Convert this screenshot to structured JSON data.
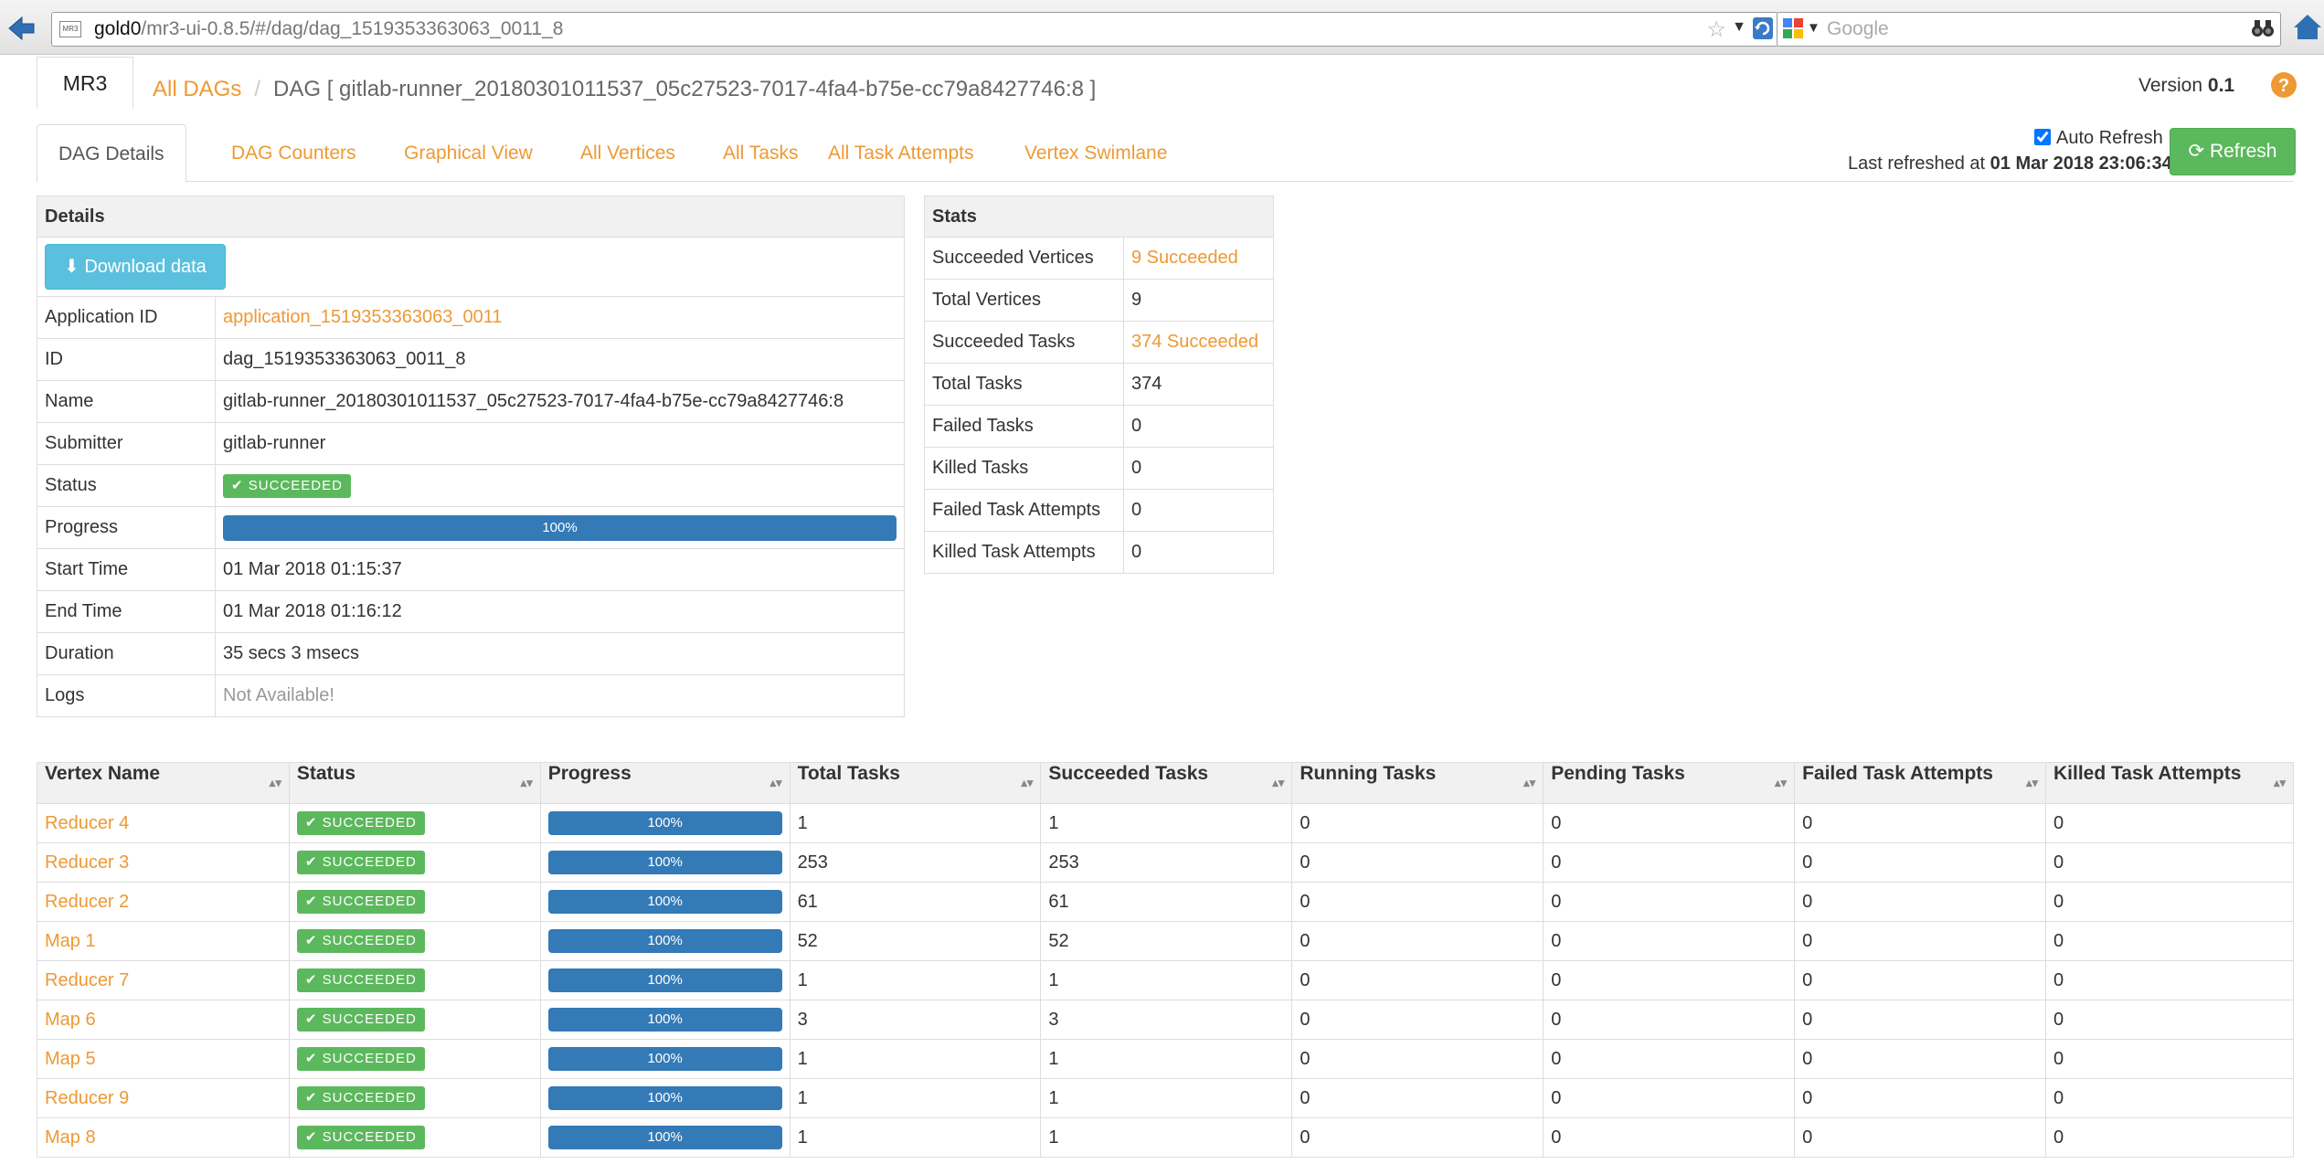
{
  "browser": {
    "url_host": "gold0",
    "url_path": "/mr3-ui-0.8.5/#/dag/dag_1519353363063_0011_8",
    "favicon_text": "MR3",
    "search_placeholder": "Google"
  },
  "header": {
    "logo": "MR3",
    "breadcrumb_root": "All DAGs",
    "breadcrumb_separator": "/",
    "breadcrumb_current": "DAG [ gitlab-runner_20180301011537_05c27523-7017-4fa4-b75e-cc79a8427746:8 ]",
    "version_label": "Version",
    "version_value": "0.1"
  },
  "tabs": [
    {
      "label": "DAG Details",
      "active": true
    },
    {
      "label": "DAG Counters"
    },
    {
      "label": "Graphical View"
    },
    {
      "label": "All Vertices"
    },
    {
      "label": "All Tasks"
    },
    {
      "label": "All Task Attempts"
    },
    {
      "label": "Vertex Swimlane"
    }
  ],
  "refresh": {
    "auto_refresh_label": "Auto Refresh",
    "auto_refresh_checked": true,
    "last_refreshed_label": "Last refreshed at",
    "last_refreshed_value": "01 Mar 2018 23:06:34",
    "button_label": "Refresh"
  },
  "details": {
    "title": "Details",
    "download_label": "Download data",
    "rows": {
      "application_id": {
        "label": "Application ID",
        "value": "application_1519353363063_0011"
      },
      "id": {
        "label": "ID",
        "value": "dag_1519353363063_0011_8"
      },
      "name": {
        "label": "Name",
        "value": "gitlab-runner_20180301011537_05c27523-7017-4fa4-b75e-cc79a8427746:8"
      },
      "submitter": {
        "label": "Submitter",
        "value": "gitlab-runner"
      },
      "status": {
        "label": "Status",
        "value": "SUCCEEDED"
      },
      "progress": {
        "label": "Progress",
        "value": "100%",
        "fraction": 1.0
      },
      "start_time": {
        "label": "Start Time",
        "value": "01 Mar 2018 01:15:37"
      },
      "end_time": {
        "label": "End Time",
        "value": "01 Mar 2018 01:16:12"
      },
      "duration": {
        "label": "Duration",
        "value": "35 secs 3 msecs"
      },
      "logs": {
        "label": "Logs",
        "value": "Not Available!"
      }
    }
  },
  "stats": {
    "title": "Stats",
    "rows": [
      {
        "label": "Succeeded Vertices",
        "value": "9 Succeeded",
        "link": true
      },
      {
        "label": "Total Vertices",
        "value": "9"
      },
      {
        "label": "Succeeded Tasks",
        "value": "374 Succeeded",
        "link": true
      },
      {
        "label": "Total Tasks",
        "value": "374"
      },
      {
        "label": "Failed Tasks",
        "value": "0"
      },
      {
        "label": "Killed Tasks",
        "value": "0"
      },
      {
        "label": "Failed Task Attempts",
        "value": "0"
      },
      {
        "label": "Killed Task Attempts",
        "value": "0"
      }
    ]
  },
  "vertices": {
    "columns": [
      "Vertex Name",
      "Status",
      "Progress",
      "Total Tasks",
      "Succeeded Tasks",
      "Running Tasks",
      "Pending Tasks",
      "Failed Task Attempts",
      "Killed Task Attempts"
    ],
    "rows": [
      {
        "name": "Reducer 4",
        "status": "SUCCEEDED",
        "progress": "100%",
        "total": "1",
        "succeeded": "1",
        "running": "0",
        "pending": "0",
        "failed": "0",
        "killed": "0"
      },
      {
        "name": "Reducer 3",
        "status": "SUCCEEDED",
        "progress": "100%",
        "total": "253",
        "succeeded": "253",
        "running": "0",
        "pending": "0",
        "failed": "0",
        "killed": "0"
      },
      {
        "name": "Reducer 2",
        "status": "SUCCEEDED",
        "progress": "100%",
        "total": "61",
        "succeeded": "61",
        "running": "0",
        "pending": "0",
        "failed": "0",
        "killed": "0"
      },
      {
        "name": "Map 1",
        "status": "SUCCEEDED",
        "progress": "100%",
        "total": "52",
        "succeeded": "52",
        "running": "0",
        "pending": "0",
        "failed": "0",
        "killed": "0"
      },
      {
        "name": "Reducer 7",
        "status": "SUCCEEDED",
        "progress": "100%",
        "total": "1",
        "succeeded": "1",
        "running": "0",
        "pending": "0",
        "failed": "0",
        "killed": "0"
      },
      {
        "name": "Map 6",
        "status": "SUCCEEDED",
        "progress": "100%",
        "total": "3",
        "succeeded": "3",
        "running": "0",
        "pending": "0",
        "failed": "0",
        "killed": "0"
      },
      {
        "name": "Map 5",
        "status": "SUCCEEDED",
        "progress": "100%",
        "total": "1",
        "succeeded": "1",
        "running": "0",
        "pending": "0",
        "failed": "0",
        "killed": "0"
      },
      {
        "name": "Reducer 9",
        "status": "SUCCEEDED",
        "progress": "100%",
        "total": "1",
        "succeeded": "1",
        "running": "0",
        "pending": "0",
        "failed": "0",
        "killed": "0"
      },
      {
        "name": "Map 8",
        "status": "SUCCEEDED",
        "progress": "100%",
        "total": "1",
        "succeeded": "1",
        "running": "0",
        "pending": "0",
        "failed": "0",
        "killed": "0"
      }
    ]
  },
  "colors": {
    "accent": "#ee9933",
    "success": "#5cb85c",
    "progress": "#337ab7",
    "info": "#5bc0de"
  }
}
